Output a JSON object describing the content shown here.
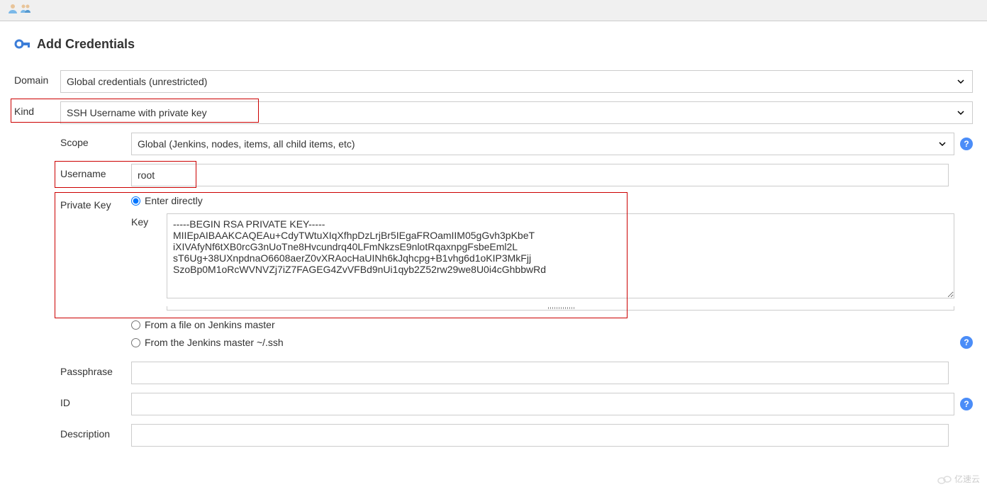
{
  "page": {
    "title": "Add Credentials"
  },
  "form": {
    "domain": {
      "label": "Domain",
      "value": "Global credentials (unrestricted)"
    },
    "kind": {
      "label": "Kind",
      "value": "SSH Username with private key"
    },
    "scope": {
      "label": "Scope",
      "value": "Global (Jenkins, nodes, items, all child items, etc)"
    },
    "username": {
      "label": "Username",
      "value": "root"
    },
    "privateKey": {
      "label": "Private Key",
      "keyLabel": "Key",
      "options": {
        "enterDirectly": "Enter directly",
        "fromFile": "From a file on Jenkins master",
        "fromSsh": "From the Jenkins master ~/.ssh"
      },
      "keyValue": "-----BEGIN RSA PRIVATE KEY-----\nMIIEpAIBAAKCAQEAu+CdyTWtuXIqXfhpDzLrjBr5IEgaFROamIIM05gGvh3pKbeT\niXIVAfyNf6tXB0rcG3nUoTne8Hvcundrq40LFmNkzsE9nlotRqaxnpgFsbeEml2L\nsT6Ug+38UXnpdnaO6608aerZ0vXRAocHaUINh6kJqhcpg+B1vhg6d1oKIP3MkFjj\nSzoBp0M1oRcWVNVZj7iZ7FAGEG4ZvVFBd9nUi1qyb2Z52rw29we8U0i4cGhbbwRd"
    },
    "passphrase": {
      "label": "Passphrase",
      "value": ""
    },
    "id": {
      "label": "ID",
      "value": ""
    },
    "description": {
      "label": "Description",
      "value": ""
    }
  },
  "watermark": "亿速云"
}
